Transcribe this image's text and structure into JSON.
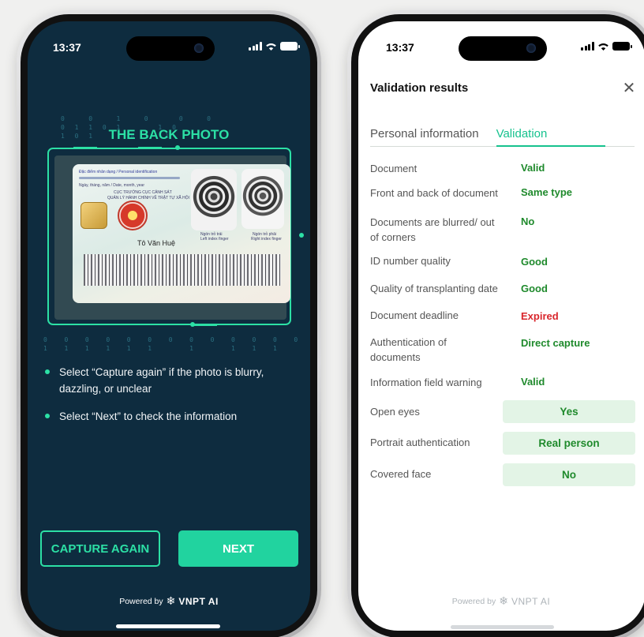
{
  "left_phone": {
    "status_time": "13:37",
    "title": "THE BACK PHOTO",
    "card": {
      "header": "Đặc điểm nhân dạng / Personal identification",
      "date_label": "Ngày, tháng, năm / Date, month, year",
      "authority_1": "CỤC TRƯỞNG CỤC CẢNH SÁT",
      "authority_2": "QUẢN LÝ HÀNH CHÍNH VỀ TRẬT TỰ XÃ HỘI",
      "left_finger": "Ngón trỏ trái",
      "left_finger_en": "Left index finger",
      "right_finger": "Ngón trỏ phải",
      "right_finger_en": "Right index finger",
      "holder_name": "Tô Văn Huệ"
    },
    "instructions": [
      "Select “Capture again” if the photo is blurry, dazzling, or unclear",
      "Select “Next” to check the information"
    ],
    "capture_again_label": "CAPTURE AGAIN",
    "next_label": "NEXT",
    "powered_by": "Powered by",
    "brand": "VNPT AI"
  },
  "right_phone": {
    "status_time": "13:37",
    "title": "Validation results",
    "close_icon": "close-icon",
    "tabs": [
      "Personal information",
      "Validation"
    ],
    "active_tab": "Validation",
    "rows": [
      {
        "label": "Document",
        "value": "Valid",
        "status": "ok"
      },
      {
        "label": "Front and back of document",
        "value": "Same type",
        "status": "ok"
      },
      {
        "label": "Documents are blurred/ out of corners",
        "value": "No",
        "status": "ok"
      },
      {
        "label": "ID number quality",
        "value": "Good",
        "status": "ok"
      },
      {
        "label": "Quality of transplanting date",
        "value": "Good",
        "status": "ok"
      },
      {
        "label": "Document deadline",
        "value": "Expired",
        "status": "error"
      },
      {
        "label": "Authentication of documents",
        "value": "Direct capture",
        "status": "ok"
      },
      {
        "label": "Information field warning",
        "value": "Valid",
        "status": "ok"
      }
    ],
    "highlight_rows": [
      {
        "label": "Open eyes",
        "value": "Yes"
      },
      {
        "label": "Portrait authentication",
        "value": "Real person"
      },
      {
        "label": "Covered face",
        "value": "No"
      }
    ],
    "powered_by": "Powered by",
    "brand": "VNPT AI"
  },
  "colors": {
    "accent_green": "#2ce0a5",
    "dark_bg": "#0e2c3f",
    "ok_text": "#1f8a2c",
    "error_text": "#d9262c",
    "chip_bg": "#e3f4e6"
  }
}
